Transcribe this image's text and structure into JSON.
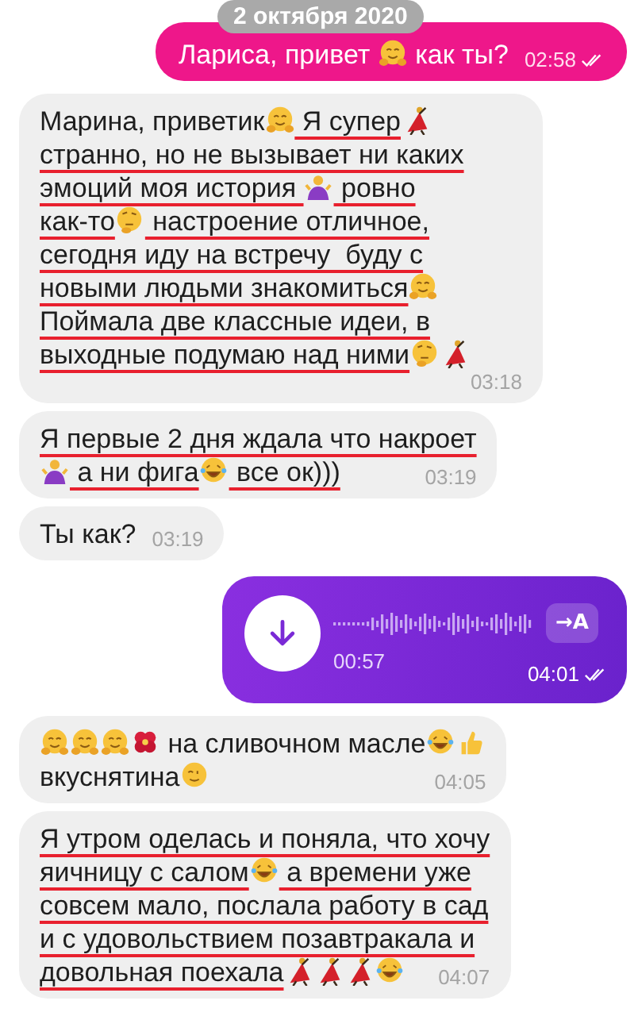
{
  "date_pill": "2 октября 2020",
  "messages": [
    {
      "kind": "text",
      "outgoing": true,
      "time": "02:58",
      "read": true,
      "lines": [
        [
          {
            "kind": "text",
            "text": "Лариса, привет ",
            "underlined": false
          },
          {
            "kind": "hug"
          },
          {
            "kind": "text",
            "text": " как ты?",
            "underlined": false
          }
        ]
      ]
    },
    {
      "kind": "text",
      "outgoing": false,
      "time": "03:18",
      "lines": [
        [
          {
            "kind": "text",
            "text": "Марина, приветик",
            "underlined": false
          },
          {
            "kind": "hug"
          },
          {
            "kind": "text",
            "text": " Я супер",
            "underlined": true
          },
          {
            "kind": "dancer"
          }
        ],
        [
          {
            "kind": "text",
            "text": "странно, но не вызывает ни каких",
            "underlined": true
          }
        ],
        [
          {
            "kind": "text",
            "text": "эмоций моя история ",
            "underlined": true
          },
          {
            "kind": "shrug"
          },
          {
            "kind": "text",
            "text": " ровно",
            "underlined": true
          }
        ],
        [
          {
            "kind": "text",
            "text": "как-то",
            "underlined": true
          },
          {
            "kind": "think"
          },
          {
            "kind": "text",
            "text": " настроение отличное,",
            "underlined": true
          }
        ],
        [
          {
            "kind": "text",
            "text": "сегодня иду на встречу  буду с",
            "underlined": true
          }
        ],
        [
          {
            "kind": "text",
            "text": "новыми людьми знакомиться",
            "underlined": true
          },
          {
            "kind": "hug"
          }
        ],
        [
          {
            "kind": "text",
            "text": "Поймала две классные идеи, в",
            "underlined": true
          }
        ],
        [
          {
            "kind": "text",
            "text": "выходные подумаю над ними",
            "underlined": true
          },
          {
            "kind": "think"
          },
          {
            "kind": "dancer"
          }
        ]
      ]
    },
    {
      "kind": "text",
      "outgoing": false,
      "time": "03:19",
      "lines": [
        [
          {
            "kind": "text",
            "text": "Я первые 2 дня ждала что накроет",
            "underlined": true
          }
        ],
        [
          {
            "kind": "shrug"
          },
          {
            "kind": "text",
            "text": " а ни фига",
            "underlined": true
          },
          {
            "kind": "laugh"
          },
          {
            "kind": "text",
            "text": " все ок)))",
            "underlined": true
          }
        ]
      ]
    },
    {
      "kind": "text",
      "outgoing": false,
      "time": "03:19",
      "lines": [
        [
          {
            "kind": "text",
            "text": "Ты как?",
            "underlined": false
          }
        ]
      ]
    },
    {
      "kind": "voice",
      "outgoing": true,
      "duration": "00:57",
      "transcribe": "→A",
      "time": "04:01",
      "read": true
    },
    {
      "kind": "text",
      "outgoing": false,
      "time": "04:05",
      "lines": [
        [
          {
            "kind": "hug"
          },
          {
            "kind": "hug"
          },
          {
            "kind": "hug"
          },
          {
            "kind": "flower"
          },
          {
            "kind": "text",
            "text": " на сливочном масле",
            "underlined": false
          },
          {
            "kind": "laugh"
          },
          {
            "kind": "thumb"
          }
        ],
        [
          {
            "kind": "text",
            "text": "вкуснятина",
            "underlined": false
          },
          {
            "kind": "wink"
          }
        ]
      ]
    },
    {
      "kind": "text",
      "outgoing": false,
      "time": "04:07",
      "lines": [
        [
          {
            "kind": "text",
            "text": "Я утром оделась и поняла, что хочу",
            "underlined": true
          }
        ],
        [
          {
            "kind": "text",
            "text": "яичницу с салом",
            "underlined": true
          },
          {
            "kind": "laugh"
          },
          {
            "kind": "text",
            "text": " а времени уже",
            "underlined": true
          }
        ],
        [
          {
            "kind": "text",
            "text": "совсем мало, послала работу в сад",
            "underlined": true
          }
        ],
        [
          {
            "kind": "text",
            "text": "и с удовольствием позавтракала и",
            "underlined": true
          }
        ],
        [
          {
            "kind": "text",
            "text": "довольная поехала",
            "underlined": true
          },
          {
            "kind": "dancer"
          },
          {
            "kind": "dancer"
          },
          {
            "kind": "dancer"
          },
          {
            "kind": "laugh"
          }
        ]
      ]
    }
  ]
}
